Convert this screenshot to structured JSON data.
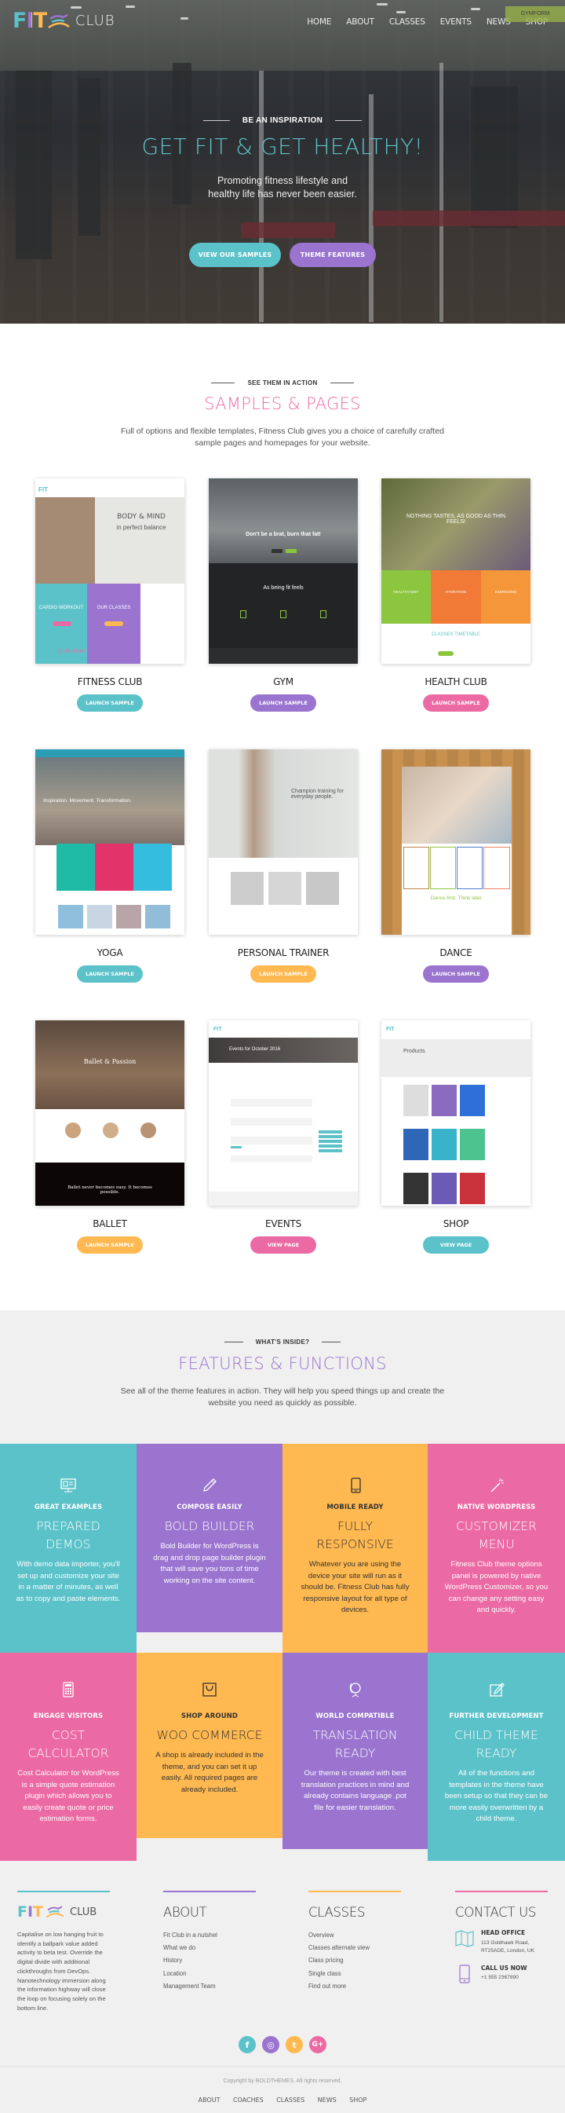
{
  "colors": {
    "teal": "#5cc2c9",
    "purple": "#9a74cf",
    "yellow": "#ffb950",
    "pink": "#ec6aa4",
    "dark": "#333333",
    "lightgray": "#f0f0f0"
  },
  "header": {
    "logo": {
      "fit": "FIT",
      "club": "CLUB"
    },
    "menu": [
      "HOME",
      "ABOUT",
      "CLASSES",
      "EVENTS",
      "NEWS",
      "SHOP"
    ],
    "badge": "GYMFORM"
  },
  "hero": {
    "kicker": "BE AN INSPIRATION",
    "title": "GET FIT & GET HEALTHY!",
    "subtitle": "Promoting fitness lifestyle and healthy life has never been easier.",
    "primary_button": "VIEW OUR SAMPLES",
    "secondary_button": "THEME FEATURES"
  },
  "samples": {
    "kicker": "SEE THEM IN ACTION",
    "title": "SAMPLES & PAGES",
    "description": "Full of options and flexible templates, Fitness Club gives you a choice of carefully crafted sample pages and homepages for your website.",
    "items": [
      {
        "name": "FITNESS CLUB",
        "button": "LAUNCH SAMPLE",
        "color": "#5cc2c9",
        "thumb": {
          "headline": "BODY & MIND",
          "sub": "in perfect balance",
          "tiles": [
            "CARDIO WORKOUT",
            "OUR CLASSES"
          ],
          "section": "CLUB NEWS"
        }
      },
      {
        "name": "GYM",
        "button": "LAUNCH SAMPLE",
        "color": "#9a74cf",
        "thumb": {
          "headline": "Don't be a brat, burn that fat!",
          "sub": "As being fit feels"
        }
      },
      {
        "name": "HEALTH CLUB",
        "button": "LAUNCH SAMPLE",
        "color": "#ec6aa4",
        "thumb": {
          "headline": "NOTHING TASTES, AS GOOD AS THIN FEELS!",
          "tiles": [
            "HEALTHY DIET",
            "HYDRATION",
            "EXERCISING"
          ],
          "section": "CLASSES TIMETABLE"
        }
      },
      {
        "name": "YOGA",
        "button": "LAUNCH SAMPLE",
        "color": "#5cc2c9",
        "thumb": {
          "headline": "Inspiration. Movement. Transformation."
        }
      },
      {
        "name": "PERSONAL TRAINER",
        "button": "LAUNCH SAMPLE",
        "color": "#ffb950",
        "thumb": {
          "headline": "Champion training for everyday people."
        }
      },
      {
        "name": "DANCE",
        "button": "LAUNCH SAMPLE",
        "color": "#9a74cf",
        "thumb": {
          "headline": "Dance first. Think later."
        }
      },
      {
        "name": "BALLET",
        "button": "LAUNCH SAMPLE",
        "color": "#ffb950",
        "thumb": {
          "headline": "Ballet & Passion",
          "sub": "Ballet never becomes easy. It becomes possible."
        }
      },
      {
        "name": "EVENTS",
        "button": "VIEW PAGE",
        "color": "#ec6aa4",
        "thumb": {
          "headline": "Events for October 2016"
        }
      },
      {
        "name": "SHOP",
        "button": "VIEW PAGE",
        "color": "#5cc2c9",
        "thumb": {
          "headline": "Products"
        }
      }
    ]
  },
  "features": {
    "kicker": "WHAT'S INSIDE?",
    "title": "FEATURES & FUNCTIONS",
    "description": "See all of the theme features in action. They will help you speed things up and create the website you need as quickly as possible.",
    "items": [
      {
        "icon": "monitor-icon",
        "kicker": "GREAT EXAMPLES",
        "title": "PREPARED DEMOS",
        "text": "With demo data importer, you'll set up and customize your site in a matter of minutes, as well as to copy and paste elements.",
        "color": "#5cc2c9"
      },
      {
        "icon": "pencil-icon",
        "kicker": "COMPOSE EASILY",
        "title": "BOLD BUILDER",
        "text": "Bold Builder for WordPress is drag and drop page builder plugin that will save you tons of time working on the site content.",
        "color": "#9a74cf"
      },
      {
        "icon": "mobile-icon",
        "kicker": "MOBILE READY",
        "title": "FULLY RESPONSIVE",
        "text": "Whatever you are using the device your site will run as it should be. Fitness Club has fully responsive layout for all type of devices.",
        "color": "#ffb950"
      },
      {
        "icon": "magic-wand-icon",
        "kicker": "NATIVE WORDPRESS",
        "title": "CUSTOMIZER MENU",
        "text": "Fitness Club theme options panel is powered by native WordPress Customizer, so you can change any setting easy and quickly.",
        "color": "#ec6aa4"
      },
      {
        "icon": "calculator-icon",
        "kicker": "ENGAGE VISITORS",
        "title": "COST CALCULATOR",
        "text": "Cost Calculator for WordPress is a simple quote estimation plugin which allows you to easily create quote or price estimation forms.",
        "color": "#ec6aa4"
      },
      {
        "icon": "shopping-bag-icon",
        "kicker": "SHOP AROUND",
        "title": "WOO COMMERCE",
        "text": "A shop is already included in the theme, and you can set it up easily. All required pages are already included.",
        "color": "#ffb950"
      },
      {
        "icon": "globe-icon",
        "kicker": "WORLD COMPATIBLE",
        "title": "TRANSLATION READY",
        "text": "Our theme is created with best translation practices in mind and already contains language .pot file for easier translation.",
        "color": "#9a74cf"
      },
      {
        "icon": "edit-icon",
        "kicker": "FURTHER DEVELOPMENT",
        "title": "CHILD THEME READY",
        "text": "All of the functions and templates in the theme have been setup so that they can be more easily overwritten by a child theme.",
        "color": "#5cc2c9"
      }
    ]
  },
  "footer": {
    "about_text": "Capitalise on low hanging fruit to identify a ballpark value added activity to beta test. Override the digital divide with additional clickthroughs from DevOps. Nanotechnology immersion along the information highway will close the loop on focusing solely on the bottom line.",
    "about": {
      "title": "ABOUT",
      "links": [
        "Fit Club in a nutshel",
        "What we do",
        "History",
        "Location",
        "Management Team"
      ]
    },
    "classes": {
      "title": "CLASSES",
      "links": [
        "Overview",
        "Classes alternate view",
        "Class pricing",
        "Single class",
        "Find out more"
      ]
    },
    "contact": {
      "title": "CONTACT US",
      "office_label": "HEAD OFFICE",
      "office_address": "113 Goldhawk Road, RT25ADE, London, UK",
      "call_label": "CALL US NOW",
      "phone": "+1 555 2367890"
    },
    "social": [
      {
        "icon": "facebook-icon",
        "glyph": "f"
      },
      {
        "icon": "instagram-icon",
        "glyph": "◎"
      },
      {
        "icon": "twitter-icon",
        "glyph": "t"
      },
      {
        "icon": "google-plus-icon",
        "glyph": "G+"
      }
    ],
    "copyright": "Copyright by BOLDTHEMES. All rights reserved.",
    "nav": [
      "ABOUT",
      "COACHES",
      "CLASSES",
      "NEWS",
      "SHOP"
    ]
  }
}
